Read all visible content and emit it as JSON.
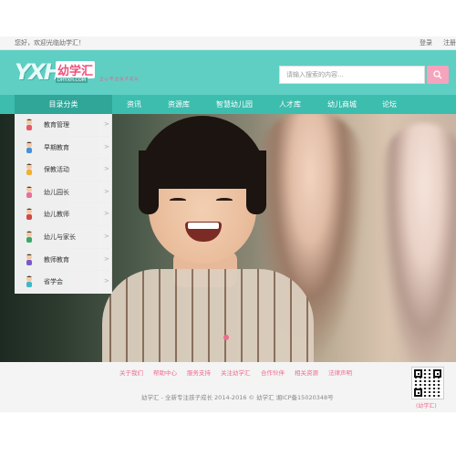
{
  "topbar": {
    "welcome": "您好，欢迎光临幼学汇！",
    "login": "登录",
    "register": "注册"
  },
  "header": {
    "logo_letters": "YXH",
    "logo_name": "幼学汇",
    "logo_domain": "DHYXH.COM",
    "slogan": "全心专注孩子成长"
  },
  "search": {
    "placeholder": "请输入搜索的内容...",
    "button_icon": "search-icon"
  },
  "nav": {
    "category_label": "目录分类",
    "items": [
      {
        "label": "资讯"
      },
      {
        "label": "资源库"
      },
      {
        "label": "智慧幼儿园"
      },
      {
        "label": "人才库"
      },
      {
        "label": "幼儿商城"
      },
      {
        "label": "论坛"
      }
    ]
  },
  "category_menu": {
    "items": [
      {
        "label": "教育管理",
        "arrow": ">"
      },
      {
        "label": "早期教育",
        "arrow": ">"
      },
      {
        "label": "保教活动",
        "arrow": ">"
      },
      {
        "label": "幼儿园长",
        "arrow": ">"
      },
      {
        "label": "幼儿教师",
        "arrow": ">"
      },
      {
        "label": "幼儿与家长",
        "arrow": ">"
      },
      {
        "label": "教师教育",
        "arrow": ">"
      },
      {
        "label": "省学会",
        "arrow": ">"
      }
    ]
  },
  "footer": {
    "links": [
      {
        "label": "关于我们"
      },
      {
        "label": "帮助中心"
      },
      {
        "label": "服务支持"
      },
      {
        "label": "关注幼学汇"
      },
      {
        "label": "合作伙伴"
      },
      {
        "label": "相关资源"
      },
      {
        "label": "法律声明"
      }
    ],
    "copyright": "幼学汇 - 全新专注孩子成长 2014-2016 © 幼学汇 湘ICP备15020348号",
    "qr_label": "(幼学汇)"
  },
  "colors": {
    "header_teal": "#5fcfc4",
    "nav_teal": "#3dbdae",
    "accent_pink": "#f06b8e"
  }
}
